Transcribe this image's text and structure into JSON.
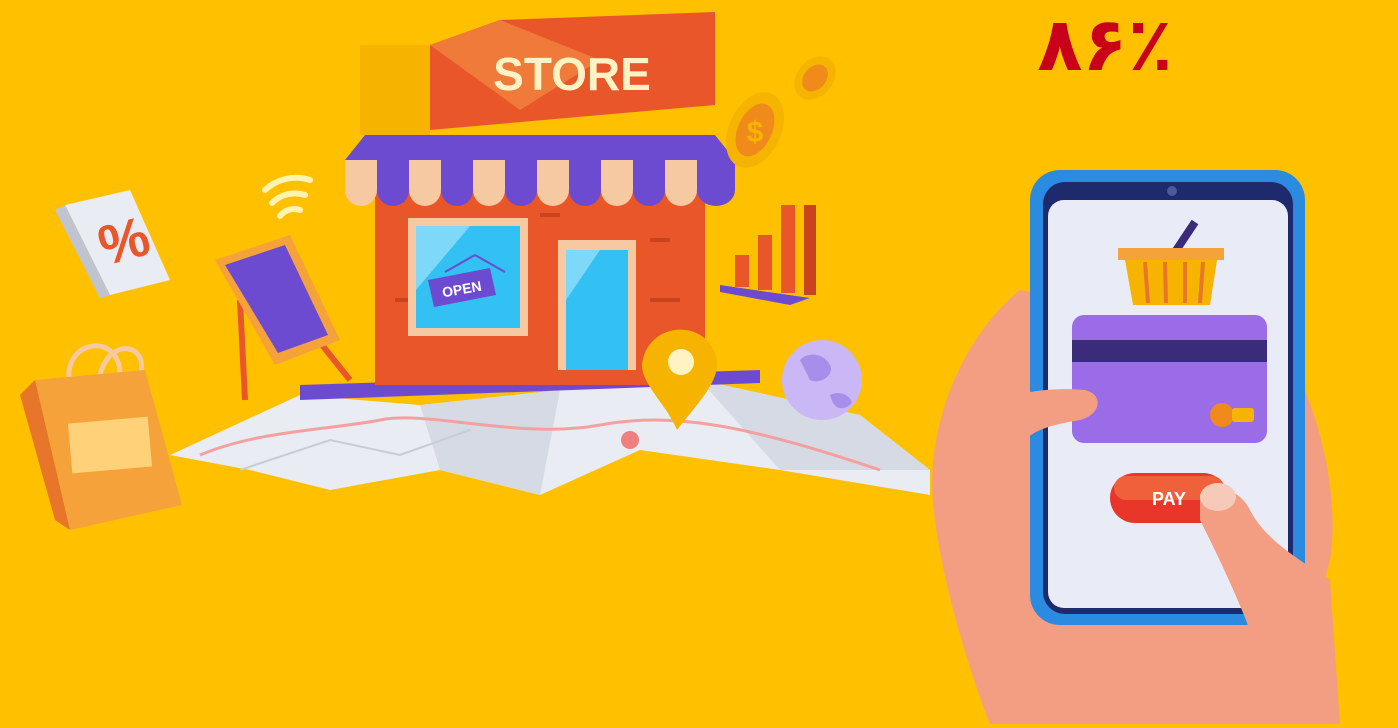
{
  "percent_label": "٨۶٪",
  "store_sign": "STORE",
  "open_sign": "OPEN",
  "pay_button": "PAY",
  "colors": {
    "background": "#FFC000",
    "percent_text": "#C8001A",
    "store_wall": "#E8562A",
    "awning_purple": "#6C4BD1",
    "phone_frame": "#2B8BE0"
  }
}
